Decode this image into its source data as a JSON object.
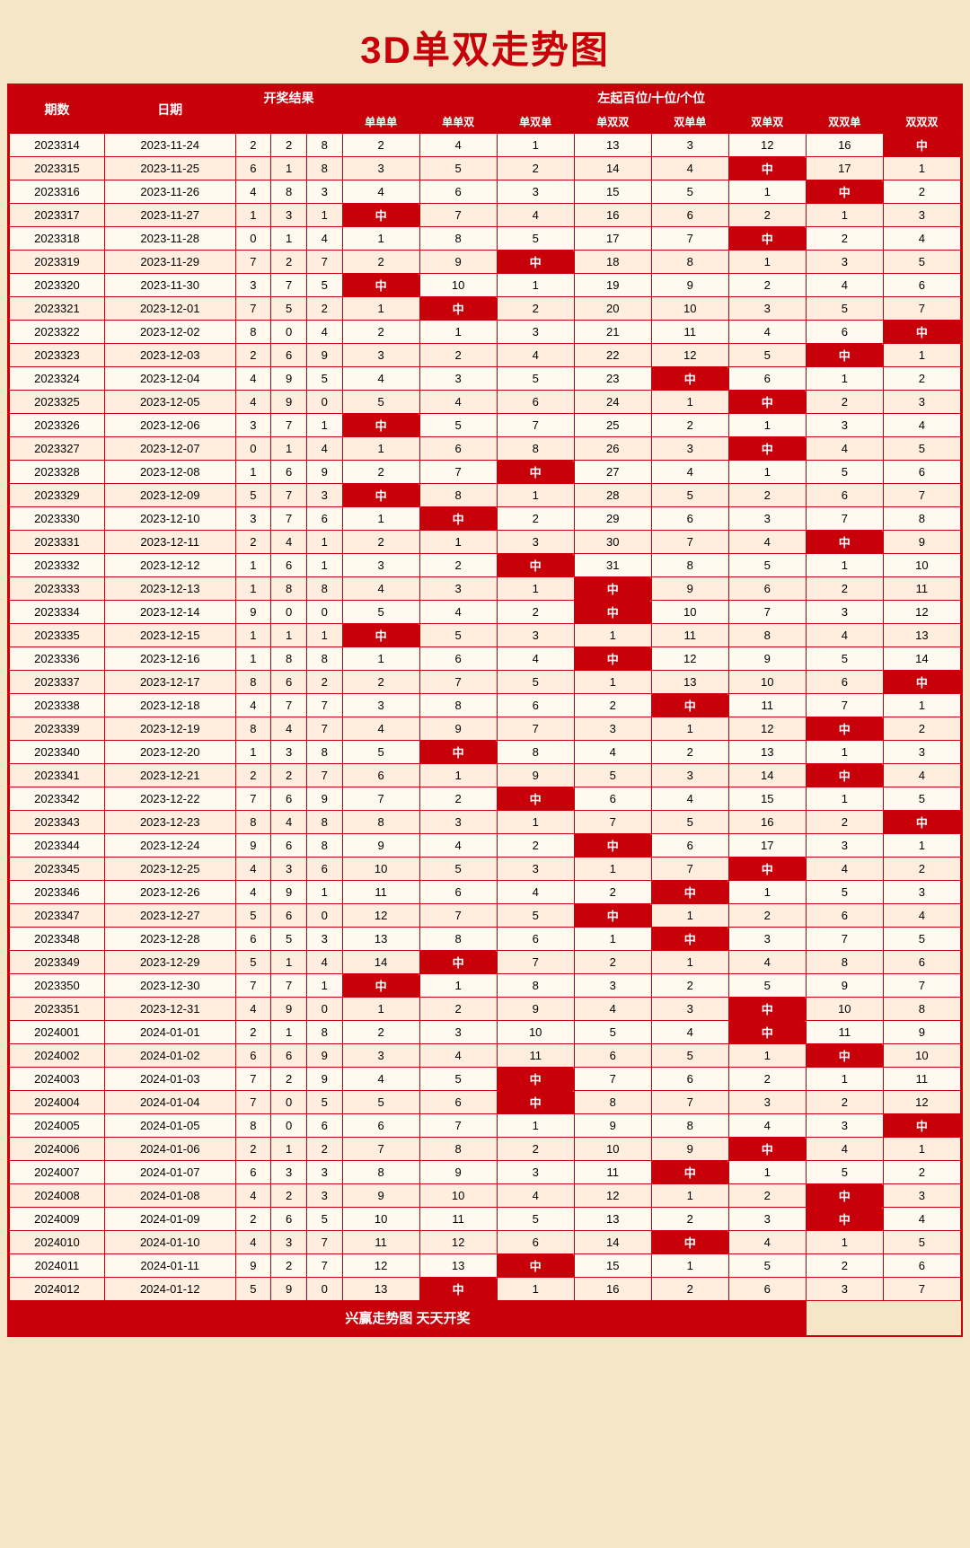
{
  "title": "3D单双走势图",
  "header": {
    "col_qishu": "期数",
    "col_date": "日期",
    "col_result": "开奖结果",
    "col_trend_label": "左起百位/十位/个位",
    "sub_headers": [
      "单单单",
      "单单双",
      "单双单",
      "单双双",
      "双单单",
      "双单双",
      "双双单",
      "双双双"
    ]
  },
  "footer": "兴赢走势图   天天开奖",
  "rows": [
    {
      "id": "2023314",
      "date": "2023-11-24",
      "r": [
        2,
        2,
        8
      ],
      "t": [
        2,
        4,
        1,
        13,
        3,
        12,
        16,
        "中"
      ]
    },
    {
      "id": "2023315",
      "date": "2023-11-25",
      "r": [
        6,
        1,
        8
      ],
      "t": [
        3,
        5,
        2,
        14,
        4,
        "中",
        17,
        1
      ]
    },
    {
      "id": "2023316",
      "date": "2023-11-26",
      "r": [
        4,
        8,
        3
      ],
      "t": [
        4,
        6,
        3,
        15,
        5,
        1,
        "中",
        2
      ]
    },
    {
      "id": "2023317",
      "date": "2023-11-27",
      "r": [
        1,
        3,
        1
      ],
      "t": [
        "中",
        7,
        4,
        16,
        6,
        2,
        1,
        3
      ]
    },
    {
      "id": "2023318",
      "date": "2023-11-28",
      "r": [
        0,
        1,
        4
      ],
      "t": [
        1,
        8,
        5,
        17,
        7,
        "中",
        2,
        4
      ]
    },
    {
      "id": "2023319",
      "date": "2023-11-29",
      "r": [
        7,
        2,
        7
      ],
      "t": [
        2,
        9,
        "中",
        18,
        8,
        1,
        3,
        5
      ]
    },
    {
      "id": "2023320",
      "date": "2023-11-30",
      "r": [
        3,
        7,
        5
      ],
      "t": [
        "中",
        10,
        1,
        19,
        9,
        2,
        4,
        6
      ]
    },
    {
      "id": "2023321",
      "date": "2023-12-01",
      "r": [
        7,
        5,
        2
      ],
      "t": [
        1,
        "中",
        2,
        20,
        10,
        3,
        5,
        7
      ]
    },
    {
      "id": "2023322",
      "date": "2023-12-02",
      "r": [
        8,
        0,
        4
      ],
      "t": [
        2,
        1,
        3,
        21,
        11,
        4,
        6,
        "中"
      ]
    },
    {
      "id": "2023323",
      "date": "2023-12-03",
      "r": [
        2,
        6,
        9
      ],
      "t": [
        3,
        2,
        4,
        22,
        12,
        5,
        "中",
        1
      ]
    },
    {
      "id": "2023324",
      "date": "2023-12-04",
      "r": [
        4,
        9,
        5
      ],
      "t": [
        4,
        3,
        5,
        23,
        "中",
        6,
        1,
        2
      ]
    },
    {
      "id": "2023325",
      "date": "2023-12-05",
      "r": [
        4,
        9,
        0
      ],
      "t": [
        5,
        4,
        6,
        24,
        1,
        "中",
        2,
        3
      ]
    },
    {
      "id": "2023326",
      "date": "2023-12-06",
      "r": [
        3,
        7,
        1
      ],
      "t": [
        "中",
        5,
        7,
        25,
        2,
        1,
        3,
        4
      ]
    },
    {
      "id": "2023327",
      "date": "2023-12-07",
      "r": [
        0,
        1,
        4
      ],
      "t": [
        1,
        6,
        8,
        26,
        3,
        "中",
        4,
        5
      ]
    },
    {
      "id": "2023328",
      "date": "2023-12-08",
      "r": [
        1,
        6,
        9
      ],
      "t": [
        2,
        7,
        "中",
        27,
        4,
        1,
        5,
        6
      ]
    },
    {
      "id": "2023329",
      "date": "2023-12-09",
      "r": [
        5,
        7,
        3
      ],
      "t": [
        "中",
        8,
        1,
        28,
        5,
        2,
        6,
        7
      ]
    },
    {
      "id": "2023330",
      "date": "2023-12-10",
      "r": [
        3,
        7,
        6
      ],
      "t": [
        1,
        "中",
        2,
        29,
        6,
        3,
        7,
        8
      ]
    },
    {
      "id": "2023331",
      "date": "2023-12-11",
      "r": [
        2,
        4,
        1
      ],
      "t": [
        2,
        1,
        3,
        30,
        7,
        4,
        "中",
        9
      ]
    },
    {
      "id": "2023332",
      "date": "2023-12-12",
      "r": [
        1,
        6,
        1
      ],
      "t": [
        3,
        2,
        "中",
        31,
        8,
        5,
        1,
        10
      ]
    },
    {
      "id": "2023333",
      "date": "2023-12-13",
      "r": [
        1,
        8,
        8
      ],
      "t": [
        4,
        3,
        1,
        "中",
        9,
        6,
        2,
        11
      ]
    },
    {
      "id": "2023334",
      "date": "2023-12-14",
      "r": [
        9,
        0,
        0
      ],
      "t": [
        5,
        4,
        2,
        "中",
        10,
        7,
        3,
        12
      ]
    },
    {
      "id": "2023335",
      "date": "2023-12-15",
      "r": [
        1,
        1,
        1
      ],
      "t": [
        "中",
        5,
        3,
        1,
        11,
        8,
        4,
        13
      ]
    },
    {
      "id": "2023336",
      "date": "2023-12-16",
      "r": [
        1,
        8,
        8
      ],
      "t": [
        1,
        6,
        4,
        "中",
        12,
        9,
        5,
        14
      ]
    },
    {
      "id": "2023337",
      "date": "2023-12-17",
      "r": [
        8,
        6,
        2
      ],
      "t": [
        2,
        7,
        5,
        1,
        13,
        10,
        6,
        "中"
      ]
    },
    {
      "id": "2023338",
      "date": "2023-12-18",
      "r": [
        4,
        7,
        7
      ],
      "t": [
        3,
        8,
        6,
        2,
        "中",
        11,
        7,
        1
      ]
    },
    {
      "id": "2023339",
      "date": "2023-12-19",
      "r": [
        8,
        4,
        7
      ],
      "t": [
        4,
        9,
        7,
        3,
        1,
        12,
        "中",
        2
      ]
    },
    {
      "id": "2023340",
      "date": "2023-12-20",
      "r": [
        1,
        3,
        8
      ],
      "t": [
        5,
        "中",
        8,
        4,
        2,
        13,
        1,
        3
      ]
    },
    {
      "id": "2023341",
      "date": "2023-12-21",
      "r": [
        2,
        2,
        7
      ],
      "t": [
        6,
        1,
        9,
        5,
        3,
        14,
        "中",
        4
      ]
    },
    {
      "id": "2023342",
      "date": "2023-12-22",
      "r": [
        7,
        6,
        9
      ],
      "t": [
        7,
        2,
        "中",
        6,
        4,
        15,
        1,
        5
      ]
    },
    {
      "id": "2023343",
      "date": "2023-12-23",
      "r": [
        8,
        4,
        8
      ],
      "t": [
        8,
        3,
        1,
        7,
        5,
        16,
        2,
        "中"
      ]
    },
    {
      "id": "2023344",
      "date": "2023-12-24",
      "r": [
        9,
        6,
        8
      ],
      "t": [
        9,
        4,
        2,
        "中",
        6,
        17,
        3,
        1
      ]
    },
    {
      "id": "2023345",
      "date": "2023-12-25",
      "r": [
        4,
        3,
        6
      ],
      "t": [
        10,
        5,
        3,
        1,
        7,
        "中",
        4,
        2
      ]
    },
    {
      "id": "2023346",
      "date": "2023-12-26",
      "r": [
        4,
        9,
        1
      ],
      "t": [
        11,
        6,
        4,
        2,
        "中",
        1,
        5,
        3
      ]
    },
    {
      "id": "2023347",
      "date": "2023-12-27",
      "r": [
        5,
        6,
        0
      ],
      "t": [
        12,
        7,
        5,
        "中",
        1,
        2,
        6,
        4
      ]
    },
    {
      "id": "2023348",
      "date": "2023-12-28",
      "r": [
        6,
        5,
        3
      ],
      "t": [
        13,
        8,
        6,
        1,
        "中",
        3,
        7,
        5
      ]
    },
    {
      "id": "2023349",
      "date": "2023-12-29",
      "r": [
        5,
        1,
        4
      ],
      "t": [
        14,
        "中",
        7,
        2,
        1,
        4,
        8,
        6
      ]
    },
    {
      "id": "2023350",
      "date": "2023-12-30",
      "r": [
        7,
        7,
        1
      ],
      "t": [
        "中",
        1,
        8,
        3,
        2,
        5,
        9,
        7
      ]
    },
    {
      "id": "2023351",
      "date": "2023-12-31",
      "r": [
        4,
        9,
        0
      ],
      "t": [
        1,
        2,
        9,
        4,
        3,
        "中",
        10,
        8
      ]
    },
    {
      "id": "2024001",
      "date": "2024-01-01",
      "r": [
        2,
        1,
        8
      ],
      "t": [
        2,
        3,
        10,
        5,
        4,
        "中",
        11,
        9
      ]
    },
    {
      "id": "2024002",
      "date": "2024-01-02",
      "r": [
        6,
        6,
        9
      ],
      "t": [
        3,
        4,
        11,
        6,
        5,
        1,
        "中",
        10
      ]
    },
    {
      "id": "2024003",
      "date": "2024-01-03",
      "r": [
        7,
        2,
        9
      ],
      "t": [
        4,
        5,
        "中",
        7,
        6,
        2,
        1,
        11
      ]
    },
    {
      "id": "2024004",
      "date": "2024-01-04",
      "r": [
        7,
        0,
        5
      ],
      "t": [
        5,
        6,
        "中",
        8,
        7,
        3,
        2,
        12
      ]
    },
    {
      "id": "2024005",
      "date": "2024-01-05",
      "r": [
        8,
        0,
        6
      ],
      "t": [
        6,
        7,
        1,
        9,
        8,
        4,
        3,
        "中"
      ]
    },
    {
      "id": "2024006",
      "date": "2024-01-06",
      "r": [
        2,
        1,
        2
      ],
      "t": [
        7,
        8,
        2,
        10,
        9,
        "中",
        4,
        1
      ]
    },
    {
      "id": "2024007",
      "date": "2024-01-07",
      "r": [
        6,
        3,
        3
      ],
      "t": [
        8,
        9,
        3,
        11,
        "中",
        1,
        5,
        2
      ]
    },
    {
      "id": "2024008",
      "date": "2024-01-08",
      "r": [
        4,
        2,
        3
      ],
      "t": [
        9,
        10,
        4,
        12,
        1,
        2,
        "中",
        3
      ]
    },
    {
      "id": "2024009",
      "date": "2024-01-09",
      "r": [
        2,
        6,
        5
      ],
      "t": [
        10,
        11,
        5,
        13,
        2,
        3,
        "中",
        4
      ]
    },
    {
      "id": "2024010",
      "date": "2024-01-10",
      "r": [
        4,
        3,
        7
      ],
      "t": [
        11,
        12,
        6,
        14,
        "中",
        4,
        1,
        5
      ]
    },
    {
      "id": "2024011",
      "date": "2024-01-11",
      "r": [
        9,
        2,
        7
      ],
      "t": [
        12,
        13,
        "中",
        15,
        1,
        5,
        2,
        6
      ]
    },
    {
      "id": "2024012",
      "date": "2024-01-12",
      "r": [
        5,
        9,
        0
      ],
      "t": [
        13,
        "中",
        1,
        16,
        2,
        6,
        3,
        7
      ]
    }
  ]
}
